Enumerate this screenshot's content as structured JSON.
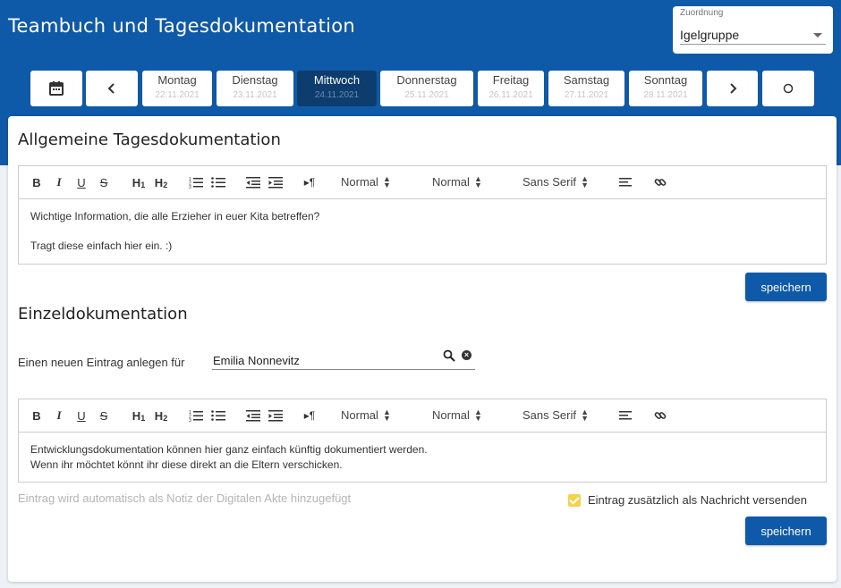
{
  "header": {
    "title": "Teambuch und Tagesdokumentation",
    "assignment": {
      "label": "Zuordnung",
      "value": "Igelgruppe"
    }
  },
  "daybar": {
    "days": [
      {
        "name": "Montag",
        "date": "22.11.2021",
        "active": false
      },
      {
        "name": "Dienstag",
        "date": "23.11.2021",
        "active": false
      },
      {
        "name": "Mittwoch",
        "date": "24.11.2021",
        "active": true
      },
      {
        "name": "Donnerstag",
        "date": "25.11.2021",
        "active": false
      },
      {
        "name": "Freitag",
        "date": "26.11.2021",
        "active": false
      },
      {
        "name": "Samstag",
        "date": "27.11.2021",
        "active": false
      },
      {
        "name": "Sonntag",
        "date": "28.11.2021",
        "active": false
      }
    ],
    "icons": {
      "calendar": "calendar-icon",
      "prev": "chevron-left-icon",
      "next": "chevron-right-icon",
      "today": "circle-icon"
    }
  },
  "toolbar": {
    "heading_size": "Normal",
    "text_size": "Normal",
    "font": "Sans Serif"
  },
  "general": {
    "heading": "Allgemeine Tagesdokumentation",
    "lines": [
      "Wichtige Information, die alle Erzieher in euer Kita betreffen?",
      "Tragt diese einfach hier ein. :)"
    ],
    "save_label": "speichern"
  },
  "individual": {
    "heading": "Einzeldokumentation",
    "entry_label": "Einen neuen Eintrag anlegen für",
    "entry_value": "Emilia  Nonnevitz",
    "lines": [
      "Entwicklungsdokumentation können hier ganz einfach künftig dokumentiert werden.",
      "Wenn ihr möchtet könnt ihr diese direkt an die Eltern verschicken."
    ],
    "note": "Eintrag wird automatisch als Notiz der Digitalen Akte hinzugefügt",
    "checkbox_label": "Eintrag zusätzlich als Nachricht versenden",
    "checkbox_checked": true,
    "save_label": "speichern"
  },
  "colors": {
    "brand": "#0f5aa8",
    "active_day": "#0c3d6e",
    "checkbox": "#f6d24b"
  }
}
